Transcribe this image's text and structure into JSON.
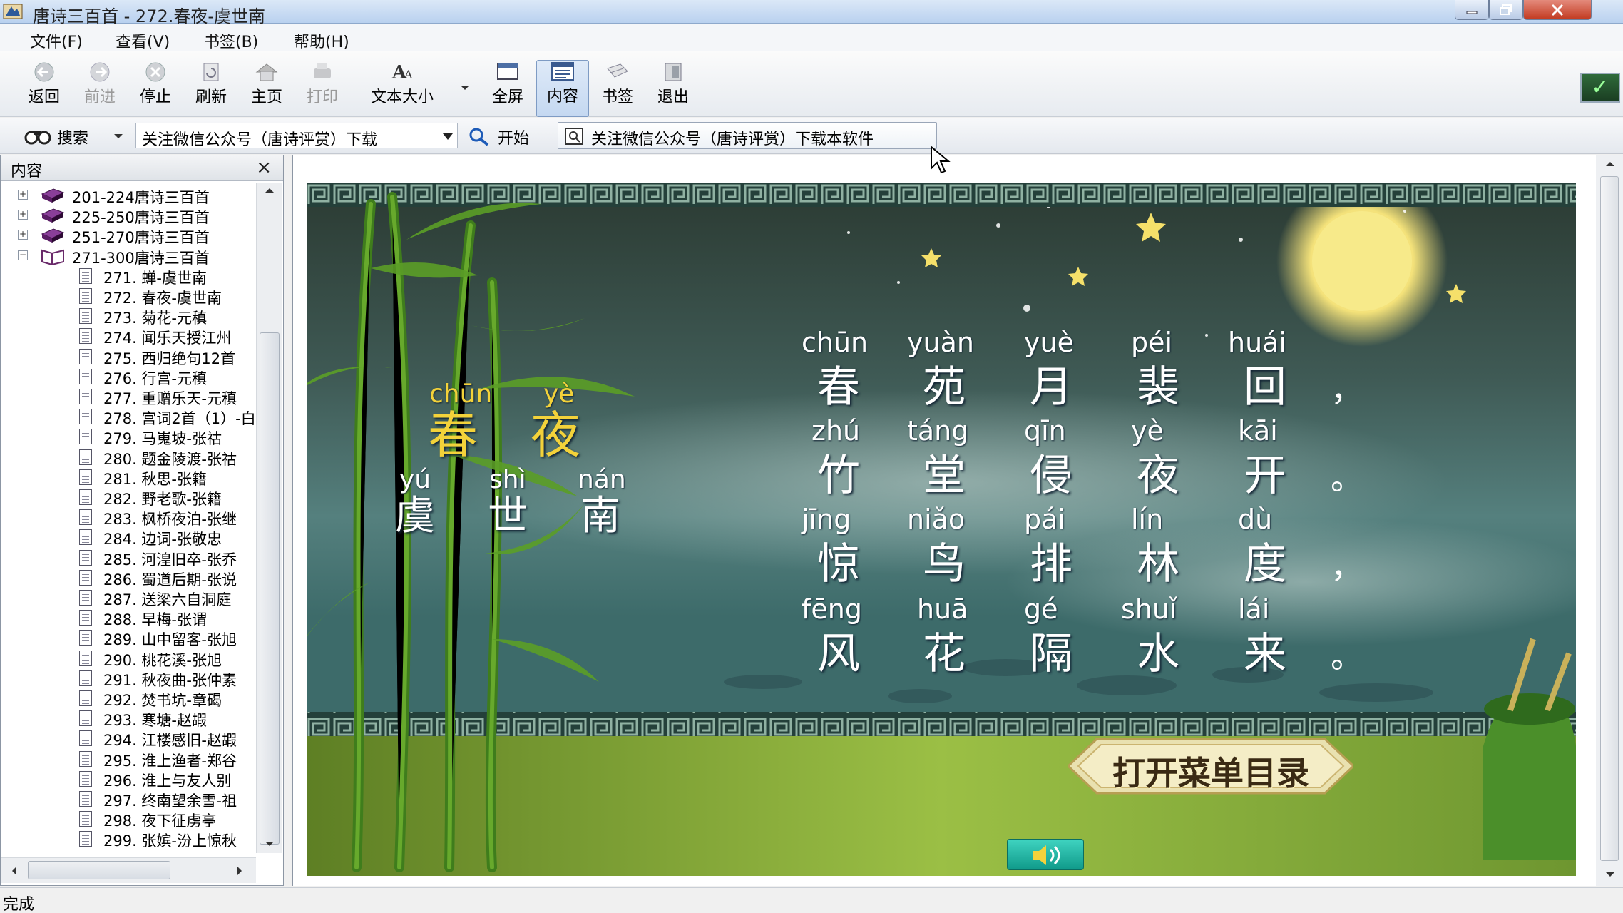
{
  "window": {
    "title": "唐诗三百首 - 272.春夜-虞世南"
  },
  "menu": [
    "文件(F)",
    "查看(V)",
    "书签(B)",
    "帮助(H)"
  ],
  "toolbar": {
    "back": "返回",
    "forward": "前进",
    "stop": "停止",
    "refresh": "刷新",
    "home": "主页",
    "print": "打印",
    "text_size": "文本大小",
    "fullscreen": "全屏",
    "contents": "内容",
    "bookmarks": "书签",
    "exit": "退出"
  },
  "searchbar": {
    "search_label": "搜索",
    "combo_value": "关注微信公众号（唐诗评赏）下载",
    "start_label": "开始",
    "link_text": "关注微信公众号（唐诗评赏）下载本软件"
  },
  "pane": {
    "title": "内容",
    "close": "×",
    "groups": [
      "201-224唐诗三百首",
      "225-250唐诗三百首",
      "251-270唐诗三百首",
      "271-300唐诗三百首"
    ],
    "items": [
      "271. 蝉-虞世南",
      "272. 春夜-虞世南",
      "273. 菊花-元稹",
      "274. 闻乐天授江州",
      "275. 西归绝句12首",
      "276. 行宫-元稹",
      "277. 重赠乐天-元稹",
      "278. 宫词2首（1）-白",
      "279. 马嵬坡-张祜",
      "280. 题金陵渡-张祜",
      "281. 秋思-张籍",
      "282. 野老歌-张籍",
      "283. 枫桥夜泊-张继",
      "284. 边词-张敬忠",
      "285. 河湟旧卒-张乔",
      "286. 蜀道后期-张说",
      "287. 送梁六自洞庭",
      "288. 早梅-张谓",
      "289. 山中留客-张旭",
      "290. 桃花溪-张旭",
      "291. 秋夜曲-张仲素",
      "292. 焚书坑-章碣",
      "293. 寒塘-赵嘏",
      "294. 江楼感旧-赵嘏",
      "295. 淮上渔者-郑谷",
      "296. 淮上与友人别",
      "297. 终南望余雪-祖",
      "298. 夜下征虏亭",
      "299. 张嫔-汾上惊秋"
    ]
  },
  "poem": {
    "title_pinyin": [
      "chūn",
      "yè"
    ],
    "title_chars": [
      "春",
      "夜"
    ],
    "author_pinyin": [
      "yú",
      "shì",
      "nán"
    ],
    "author_chars": [
      "虞",
      "世",
      "南"
    ],
    "lines": [
      {
        "pinyin": [
          "chūn",
          "yuàn",
          "yuè",
          "péi",
          "huái"
        ],
        "chars": [
          "春",
          "苑",
          "月",
          "裴",
          "回"
        ],
        "punct": "，"
      },
      {
        "pinyin": [
          "zhú",
          "táng",
          "qīn",
          "yè",
          "kāi"
        ],
        "chars": [
          "竹",
          "堂",
          "侵",
          "夜",
          "开"
        ],
        "punct": "。"
      },
      {
        "pinyin": [
          "jīng",
          "niǎo",
          "pái",
          "lín",
          "dù"
        ],
        "chars": [
          "惊",
          "鸟",
          "排",
          "林",
          "度"
        ],
        "punct": "，"
      },
      {
        "pinyin": [
          "fēng",
          "huā",
          "gé",
          "shuǐ",
          "lái"
        ],
        "chars": [
          "风",
          "花",
          "隔",
          "水",
          "来"
        ],
        "punct": "。"
      }
    ],
    "menu_button": "打开菜单目录"
  },
  "status": "完成",
  "colors": {
    "title_yellow": "#f3d23a",
    "sky_dark": "#1f3b3e",
    "grass": "#8fb63c"
  }
}
